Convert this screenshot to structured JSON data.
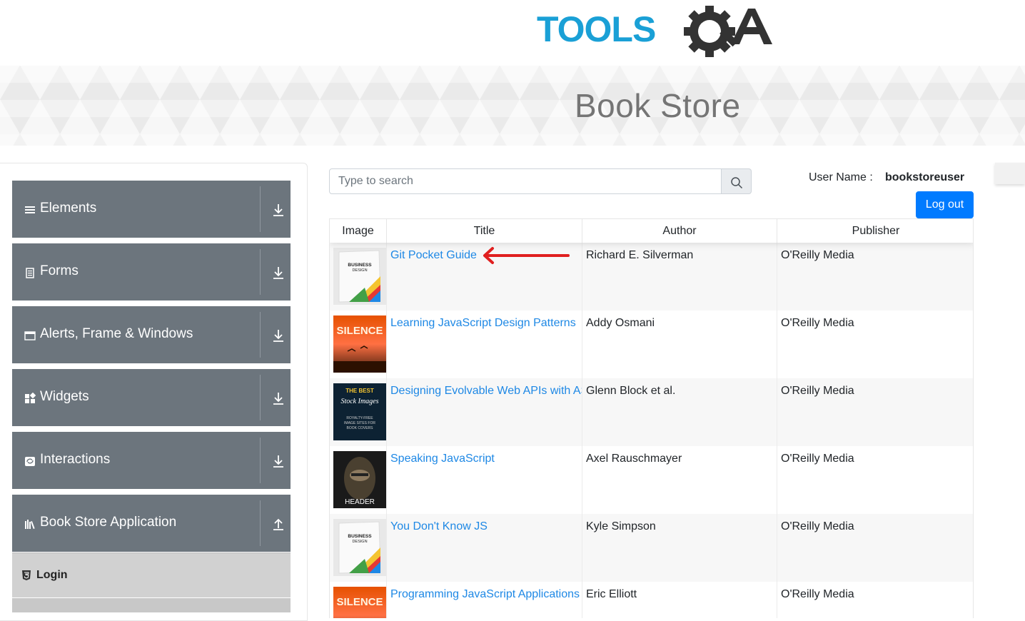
{
  "header": {
    "logo_text": "TOOLSQA",
    "page_title": "Book Store"
  },
  "colors": {
    "logo_blue": "#1aa0d6",
    "logo_dark": "#333333",
    "sidebar_group": "#6c757d",
    "link": "#1e88e5",
    "primary_button": "#007bff"
  },
  "sidebar": {
    "groups": [
      {
        "label": "Elements",
        "icon": "hamburger-icon",
        "state": "collapsed"
      },
      {
        "label": "Forms",
        "icon": "document-icon",
        "state": "collapsed"
      },
      {
        "label": "Alerts, Frame & Windows",
        "icon": "window-icon",
        "state": "collapsed"
      },
      {
        "label": "Widgets",
        "icon": "widgets-icon",
        "state": "collapsed"
      },
      {
        "label": "Interactions",
        "icon": "interactions-icon",
        "state": "collapsed"
      },
      {
        "label": "Book Store Application",
        "icon": "books-icon",
        "state": "expanded"
      }
    ],
    "items": [
      {
        "label": "Login",
        "icon": "html5-icon"
      }
    ]
  },
  "search": {
    "placeholder": "Type to search",
    "value": ""
  },
  "user": {
    "label": "User Name :",
    "value": "bookstoreuser",
    "logout_label": "Log out"
  },
  "table": {
    "columns": [
      "Image",
      "Title",
      "Author",
      "Publisher"
    ],
    "rows": [
      {
        "cover": "business-design-cover",
        "title": "Git Pocket Guide",
        "author": "Richard E. Silverman",
        "publisher": "O'Reilly Media"
      },
      {
        "cover": "silence-cover",
        "title": "Learning JavaScript Design Patterns",
        "author": "Addy Osmani",
        "publisher": "O'Reilly Media"
      },
      {
        "cover": "best-stock-images-cover",
        "title": "Designing Evolvable Web APIs with ASP.NET",
        "author": "Glenn Block et al.",
        "publisher": "O'Reilly Media"
      },
      {
        "cover": "header-cover",
        "title": "Speaking JavaScript",
        "author": "Axel Rauschmayer",
        "publisher": "O'Reilly Media"
      },
      {
        "cover": "business-design-cover",
        "title": "You Don't Know JS",
        "author": "Kyle Simpson",
        "publisher": "O'Reilly Media"
      },
      {
        "cover": "silence-cover",
        "title": "Programming JavaScript Applications",
        "author": "Eric Elliott",
        "publisher": "O'Reilly Media"
      }
    ]
  },
  "covers": {
    "business_design": {
      "line1": "BUSINESS",
      "line2": "DESIGN"
    },
    "silence": {
      "title": "SILENCE"
    },
    "best_stock": {
      "line1": "THE BEST",
      "line2": "Stock Images",
      "line3": "ROYALTY-FREE",
      "line4": "IMAGE SITES FOR",
      "line5": "BOOK COVERS"
    },
    "header_cover": {
      "title": "HEADER"
    }
  },
  "annotation": {
    "arrow_color": "#e02020"
  }
}
